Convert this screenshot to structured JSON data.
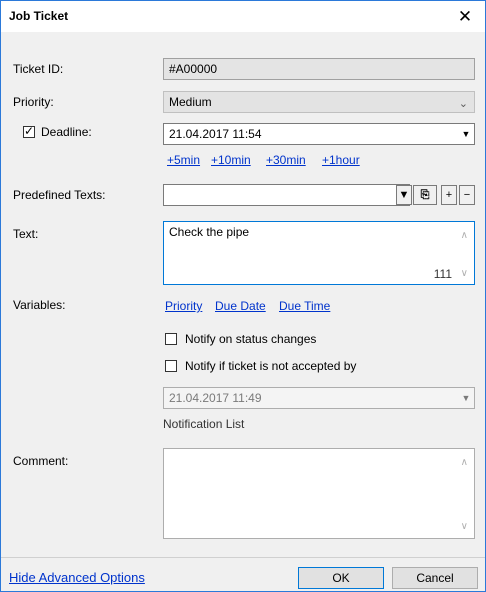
{
  "window": {
    "title": "Job Ticket",
    "close_glyph": "✕"
  },
  "form": {
    "ticket_id": {
      "label": "Ticket ID:",
      "value": "#A00000"
    },
    "priority": {
      "label": "Priority:",
      "value": "Medium"
    },
    "deadline": {
      "label": "Deadline:",
      "checked": true,
      "value": "21.04.2017 11:54",
      "quick_links": [
        "+5min",
        "+10min",
        "+30min",
        "+1hour"
      ]
    },
    "predefined_texts": {
      "label": "Predefined Texts:",
      "value": ""
    },
    "text": {
      "label": "Text:",
      "value": "Check the pipe",
      "char_count": "111"
    },
    "variables": {
      "label": "Variables:",
      "links": [
        "Priority",
        "Due Date",
        "Due Time"
      ]
    },
    "notify_status": {
      "label": "Notify on status changes",
      "checked": false
    },
    "notify_accept": {
      "label": "Notify if ticket is not accepted by",
      "checked": false
    },
    "notify_date": {
      "value": "21.04.2017 11:49"
    },
    "notification_list": {
      "label": "Notification List"
    },
    "comment": {
      "label": "Comment:",
      "value": ""
    }
  },
  "footer": {
    "advanced_link": "Hide Advanced Options",
    "ok": "OK",
    "cancel": "Cancel"
  }
}
